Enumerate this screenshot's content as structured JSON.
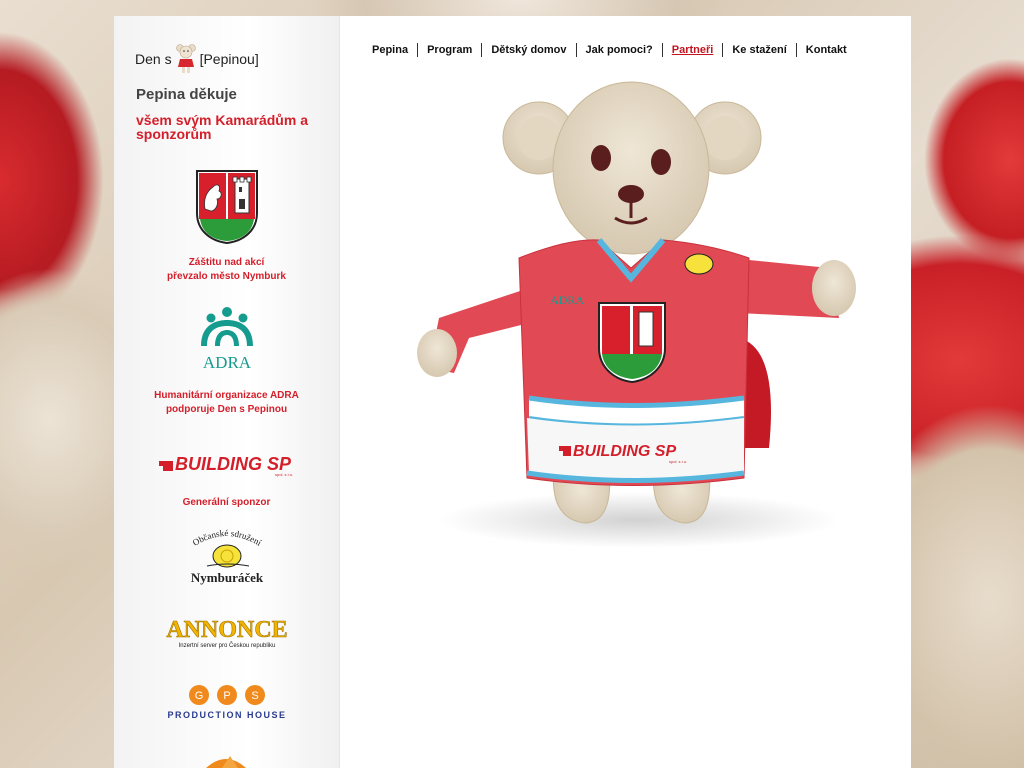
{
  "site": {
    "title_prefix": "Den s",
    "title_suffix": "[Pepinou]"
  },
  "sidebar": {
    "heading": "Pepina děkuje",
    "subheading": "všem svým Kamarádům a sponzorům",
    "sponsors": [
      {
        "logo": "nymburk-coat-of-arms",
        "caption_line1": "Záštitu nad akcí",
        "caption_line2": "převzalo město Nymburk"
      },
      {
        "logo": "adra-logo",
        "logo_text": "ADRA",
        "caption_line1": "Humanitární organizace ADRA",
        "caption_line2": "podporuje Den s Pepinou"
      },
      {
        "logo": "building-sp-logo",
        "logo_text": "BUILDING SP",
        "logo_small": "spol. s r.o.",
        "caption_line1": "Generální sponzor"
      },
      {
        "logo": "nymburacek-logo",
        "logo_text_top": "Občanské sdružení",
        "logo_text_bottom": "Nymburáček"
      },
      {
        "logo": "annonce-logo",
        "logo_text": "ANNONCE",
        "logo_small": "Inzertní server pro Českou republiku"
      },
      {
        "logo": "gps-logo",
        "logo_text": "PRODUCTION HOUSE",
        "logo_letters": [
          "G",
          "P",
          "S"
        ]
      }
    ]
  },
  "nav": {
    "items": [
      "Pepina",
      "Program",
      "Dětský domov",
      "Jak pomoci?",
      "Partneři",
      "Ke stažení",
      "Kontakt"
    ],
    "active": "Partneři"
  },
  "hero": {
    "jersey_sponsor": "BUILDING SP",
    "jersey_small": "spol. s r.o.",
    "jersey_badge": "ADRA"
  },
  "colors": {
    "accent": "#d41f2a",
    "jersey": "#e14a55"
  }
}
